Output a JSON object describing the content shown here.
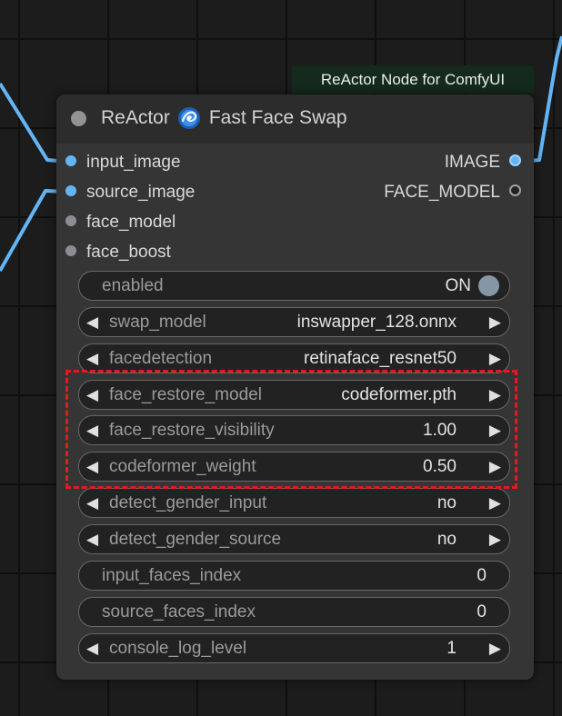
{
  "group": {
    "title": "ReActor Node for ComfyUI"
  },
  "node": {
    "title_prefix": "ReActor",
    "title_icon": "galaxy-icon",
    "title_suffix": "Fast Face Swap",
    "inputs": [
      {
        "label": "input_image",
        "type": "IMAGE",
        "connected": true
      },
      {
        "label": "source_image",
        "type": "IMAGE",
        "connected": true
      },
      {
        "label": "face_model",
        "type": "FACE_MODEL",
        "connected": false
      },
      {
        "label": "face_boost",
        "type": "FACE_BOOST",
        "connected": false
      }
    ],
    "outputs": [
      {
        "label": "IMAGE",
        "connected": true
      },
      {
        "label": "FACE_MODEL",
        "connected": false
      }
    ],
    "widgets": {
      "enabled": {
        "label": "enabled",
        "value": "ON"
      },
      "swap_model": {
        "label": "swap_model",
        "value": "inswapper_128.onnx"
      },
      "facedetection": {
        "label": "facedetection",
        "value": "retinaface_resnet50"
      },
      "face_restore_model": {
        "label": "face_restore_model",
        "value": "codeformer.pth"
      },
      "face_restore_visibility": {
        "label": "face_restore_visibility",
        "value": "1.00"
      },
      "codeformer_weight": {
        "label": "codeformer_weight",
        "value": "0.50"
      },
      "detect_gender_input": {
        "label": "detect_gender_input",
        "value": "no"
      },
      "detect_gender_source": {
        "label": "detect_gender_source",
        "value": "no"
      },
      "input_faces_index": {
        "label": "input_faces_index",
        "value": "0"
      },
      "source_faces_index": {
        "label": "source_faces_index",
        "value": "0"
      },
      "console_log_level": {
        "label": "console_log_level",
        "value": "1"
      }
    },
    "arrows": {
      "left": "◀",
      "right": "▶"
    }
  },
  "colors": {
    "wire": "#64b5f6",
    "highlight": "#e8191c",
    "group_title_bg": "#142a1c",
    "toggle_knob": "#8597a6"
  }
}
